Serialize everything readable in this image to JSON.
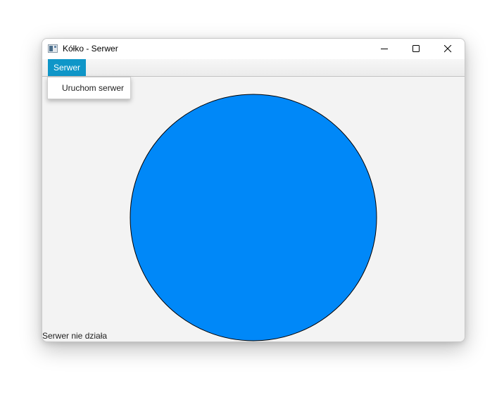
{
  "window": {
    "title": "Kółko - Serwer",
    "controls": {
      "minimize_icon": "minimize-icon",
      "maximize_icon": "maximize-icon",
      "close_icon": "close-icon"
    }
  },
  "menubar": {
    "items": [
      {
        "label": "Serwer",
        "active": true
      }
    ]
  },
  "menu_dropdown": {
    "items": [
      {
        "label": "Uruchom serwer"
      }
    ]
  },
  "canvas": {
    "shape": "circle",
    "fill": "#0088f8",
    "stroke": "#000000"
  },
  "status": {
    "text": "Serwer nie działa"
  },
  "colors": {
    "menu_active": "#0f96c8",
    "background": "#f3f3f3"
  }
}
